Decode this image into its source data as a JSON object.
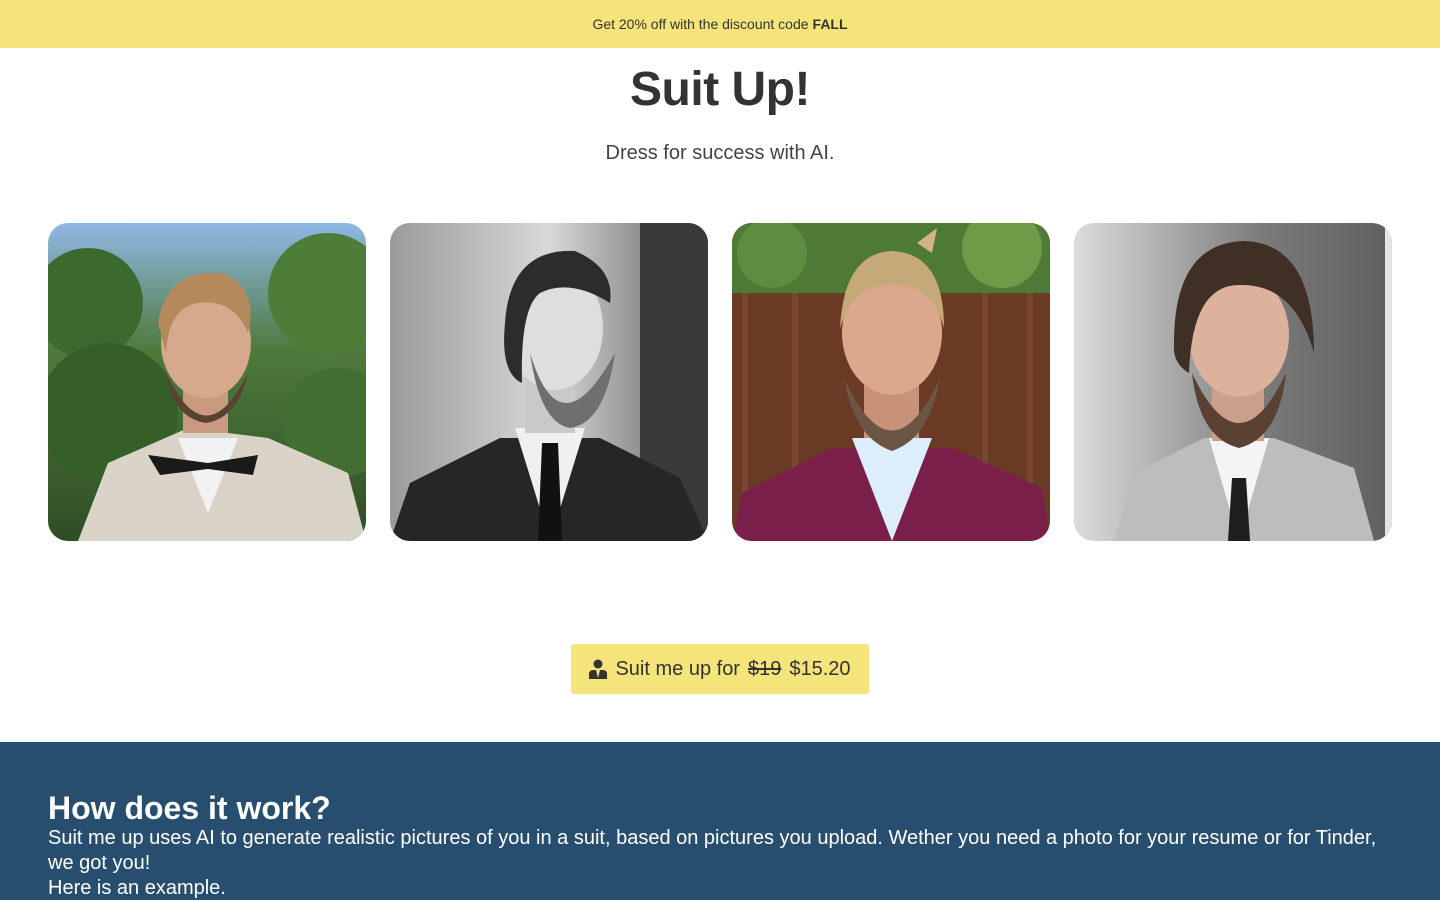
{
  "promo": {
    "text": "Get 20% off with the discount code",
    "code": "FALL"
  },
  "hero": {
    "title": "Suit Up!",
    "subtitle": "Dress for success with AI."
  },
  "gallery": {
    "images": [
      {
        "name": "portrait-outdoor-bowtie"
      },
      {
        "name": "portrait-black-white-profile"
      },
      {
        "name": "portrait-burgundy-jacket"
      },
      {
        "name": "portrait-grey-suit-studio"
      }
    ]
  },
  "cta": {
    "icon": "person-suit-icon",
    "label": "Suit me up for",
    "old_price": "$19",
    "new_price": "$15.20"
  },
  "how": {
    "title": "How does it work?",
    "description": "Suit me up uses AI to generate realistic pictures of you in a suit, based on pictures you upload. Wether you need a photo for your resume or for Tinder, we got you!",
    "example": "Here is an example."
  },
  "colors": {
    "accent": "#f5e47a",
    "section_bg": "#274e6f",
    "text": "#333333"
  }
}
